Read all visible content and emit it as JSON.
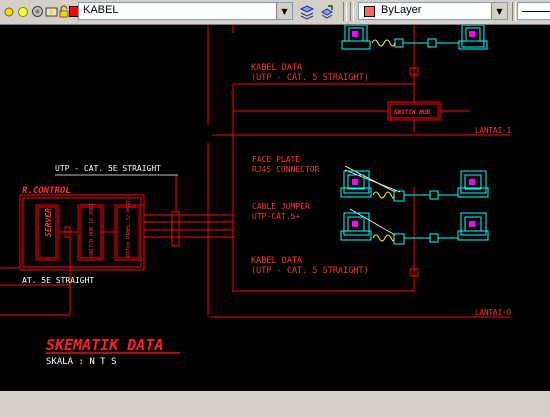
{
  "toolbar": {
    "layer_combo_value": "KABEL",
    "color_combo_value": "ByLayer",
    "layer_color": "#ff0000",
    "icons": [
      "layer-state-icon",
      "layer-on-icon",
      "layer-freeze-icon",
      "layer-lock-icon",
      "layer-color-swatch",
      "make-object-layer-current-icon",
      "layer-previous-icon"
    ]
  },
  "drawing": {
    "colors": {
      "red": "#ff0000",
      "cyan": "#00ffff",
      "white": "#ffffff",
      "yellow": "#ffff00",
      "magenta": "#ff00ff"
    },
    "labels": {
      "kabel_data_top": "KABEL DATA",
      "utp_cat5_top": "(UTP - CAT. 5 STRAIGHT)",
      "switch_hub": "SWITCH HUB",
      "lantai_1": "LANTAI-1",
      "face_plate": "FACE PLATE",
      "rj45_connector": "RJ45 CONNECTOR",
      "cable_jumper": "CABLE JUMPER",
      "utp_cat5_plus": "UTP-CAT.5+",
      "kabel_data_bottom": "KABEL DATA",
      "utp_cat5_bottom": "(UTP - CAT. 5 STRAIGHT)",
      "lantai_0": "LANTAI-0",
      "utp_cat5e_top": "UTP - CAT. 5E STRAIGHT",
      "r_control": "R.CONTROL",
      "server": "SERVER",
      "switch_hub_16port": "SWITCH HUB 16 PORT",
      "patch_panel_32port": "PATCH PANEL 32 PORT",
      "utp_cat5e_bottom": "AT. 5E STRAIGHT",
      "title": "SKEMATIK DATA",
      "scale": "SKALA : N T S"
    }
  }
}
